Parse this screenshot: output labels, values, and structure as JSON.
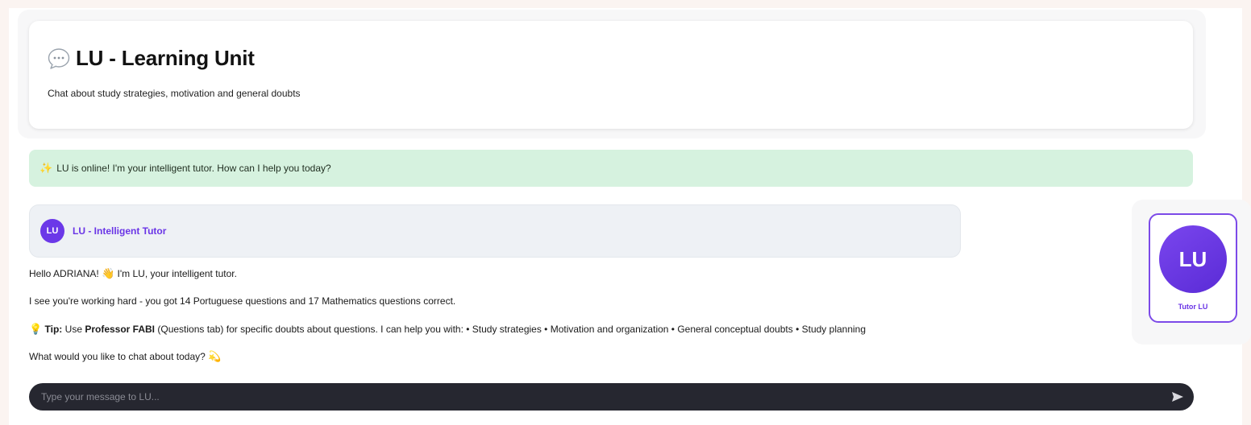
{
  "app": {
    "title": "LU - Learning Unit",
    "subtitle": "Chat about study strategies, motivation and general doubts",
    "title_icon": "speech-bubble-icon"
  },
  "status": {
    "icon": "sparkles-icon",
    "text": "LU is online! I'm your intelligent tutor. How can I help you today?"
  },
  "tutor": {
    "avatar_initials": "LU",
    "name": "LU - Intelligent Tutor"
  },
  "messages": {
    "greeting_pre": "Hello ADRIANA! ",
    "greeting_post": " I'm LU, your intelligent tutor.",
    "progress": "I see you're working hard - you got 14 Portuguese questions and 17 Mathematics questions correct.",
    "tip_label": "Tip:",
    "tip_use": " Use ",
    "tip_professor": "Professor FABI",
    "tip_rest": " (Questions tab) for specific doubts about questions. I can help you with: • Study strategies • Motivation and organization • General conceptual doubts • Study planning",
    "closing": "What would you like to chat about today? ",
    "icons": {
      "wave": "waving-hand-icon",
      "tip": "lightbulb-icon",
      "closing": "dizzy-icon"
    }
  },
  "input": {
    "placeholder": "Type your message to LU...",
    "value": ""
  },
  "side_card": {
    "avatar_initials": "LU",
    "label": "Tutor LU"
  },
  "colors": {
    "accent": "#6b38e8",
    "status_bg": "#d6f2df",
    "input_bg": "#262730",
    "page_bg": "#fbf4f1"
  }
}
